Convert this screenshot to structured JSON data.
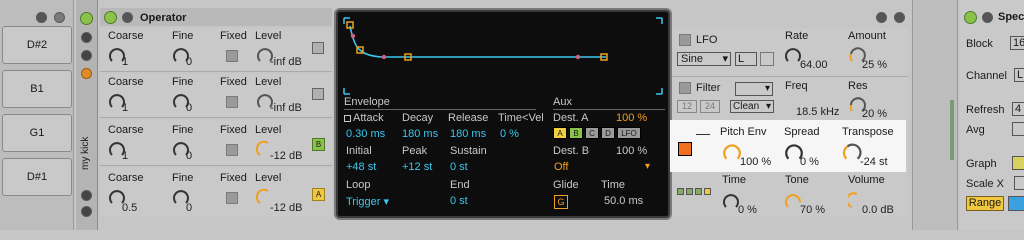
{
  "devices": {
    "drum_rack": {
      "pads": [
        "D#2",
        "B1",
        "G1",
        "D#1"
      ],
      "chain_label": "my kick"
    },
    "operator": {
      "title": "Operator",
      "headers": {
        "coarse": "Coarse",
        "fine": "Fine",
        "fixed": "Fixed",
        "level": "Level"
      },
      "oscillators": [
        {
          "coarse": "1",
          "fine": "0",
          "level": "-inf dB",
          "letter": ""
        },
        {
          "coarse": "1",
          "fine": "0",
          "level": "-inf dB",
          "letter": ""
        },
        {
          "coarse": "1",
          "fine": "0",
          "level": "-12 dB",
          "letter": "B"
        },
        {
          "coarse": "0.5",
          "fine": "0",
          "level": "-12 dB",
          "letter": "A"
        }
      ],
      "envelope": {
        "section": "Envelope",
        "attack_label": "Attack",
        "attack": "0.30 ms",
        "decay_label": "Decay",
        "decay": "180 ms",
        "release_label": "Release",
        "release": "180 ms",
        "timevel_label": "Time<Vel",
        "timevel": "0 %",
        "initial_label": "Initial",
        "initial": "+48 st",
        "peak_label": "Peak",
        "peak": "+12 st",
        "sustain_label": "Sustain",
        "sustain": "0 st",
        "loop_label": "Loop",
        "loop": "Trigger",
        "end_label": "End",
        "end": "0 st"
      },
      "aux": {
        "section": "Aux",
        "desta_label": "Dest. A",
        "desta_pct": "100 %",
        "dest_buttons": [
          "A",
          "B",
          "C",
          "D",
          "LFO"
        ],
        "destb_label": "Dest. B",
        "destb_pct": "100 %",
        "destb": "Off",
        "glide_label": "Glide",
        "glide_btn": "G",
        "time_label": "Time",
        "time": "50.0 ms"
      },
      "lfo": {
        "label": "LFO",
        "wave": "Sine",
        "mode": "L",
        "rate_label": "Rate",
        "rate": "64.00",
        "amount_label": "Amount",
        "amount": "25 %"
      },
      "filter": {
        "label": "Filter",
        "type": "Clean",
        "slopes": [
          "12",
          "24"
        ],
        "freq_label": "Freq",
        "freq": "18.5 kHz",
        "res_label": "Res",
        "res": "20 %"
      },
      "pitch": {
        "pitchenv_label": "Pitch Env",
        "pitchenv": "100 %",
        "spread_label": "Spread",
        "spread": "0 %",
        "transpose_label": "Transpose",
        "transpose": "-24 st"
      },
      "bottom": {
        "time_label": "Time",
        "time": "0 %",
        "tone_label": "Tone",
        "tone": "70 %",
        "volume_label": "Volume",
        "volume": "0.0 dB"
      }
    },
    "spectrum": {
      "title": "Spec",
      "block_label": "Block",
      "block": "16",
      "channel_label": "Channel",
      "channel": "L",
      "refresh_label": "Refresh",
      "refresh": "4",
      "avg_label": "Avg",
      "graph_label": "Graph",
      "scalex_label": "Scale X",
      "range_label": "Range"
    }
  },
  "colors": {
    "accent": "#f0a020",
    "envline": "#38c8f0",
    "active_green": "#8bc34a"
  }
}
